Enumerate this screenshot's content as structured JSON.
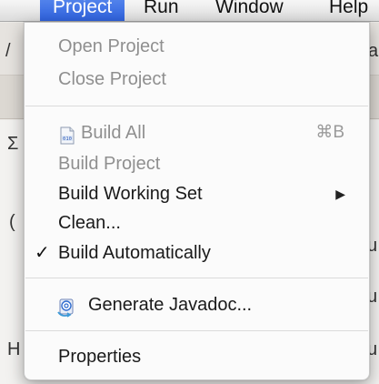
{
  "menubar": {
    "items": [
      {
        "label": "Project",
        "active": true
      },
      {
        "label": "Run"
      },
      {
        "label": "Window"
      },
      {
        "label": "Help"
      }
    ]
  },
  "background": {
    "fragments": [
      "/",
      "a",
      "Σ",
      "(",
      "u",
      "u",
      "H",
      "u"
    ]
  },
  "menu": {
    "open_project": "Open Project",
    "close_project": "Close Project",
    "build_all": "Build All",
    "build_all_shortcut": "⌘B",
    "build_project": "Build Project",
    "build_working_set": "Build Working Set",
    "submenu_arrow": "▶",
    "clean": "Clean...",
    "check_mark": "✓",
    "build_automatically": "Build Automatically",
    "generate_javadoc": "Generate Javadoc...",
    "properties": "Properties"
  },
  "icons": {
    "build_all": "binary-file-icon",
    "generate_javadoc": "javadoc-icon"
  },
  "colors": {
    "menubar_active": "#3a6ee3",
    "disabled_text": "#8f8f8f",
    "enabled_text": "#1a1a1a"
  }
}
